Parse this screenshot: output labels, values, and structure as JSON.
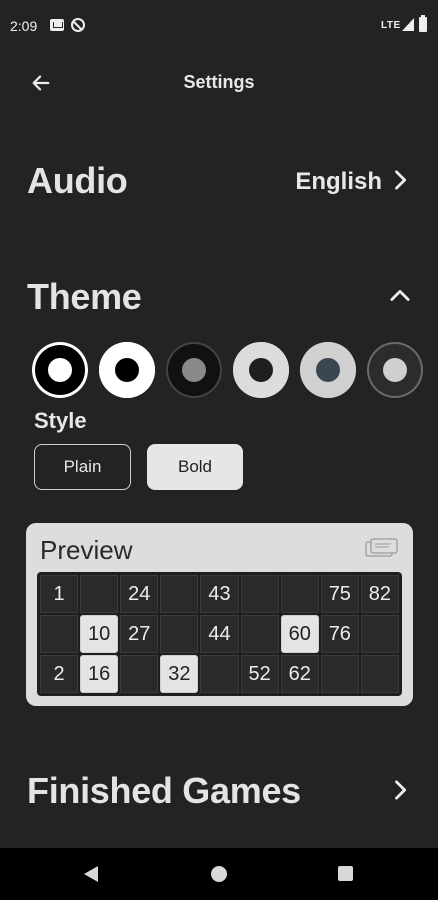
{
  "status": {
    "time": "2:09",
    "network": "LTE"
  },
  "app_bar": {
    "title": "Settings",
    "back_icon": "arrow-left-icon"
  },
  "audio": {
    "label": "Audio",
    "value": "English"
  },
  "theme": {
    "label": "Theme",
    "expanded": true,
    "swatches": [
      {
        "name": "black-white",
        "outer": "#000000",
        "ring": "#ffffff",
        "inner": "#ffffff",
        "selected": true
      },
      {
        "name": "white-black",
        "outer": "#ffffff",
        "ring": "#ffffff",
        "inner": "#000000",
        "selected": false
      },
      {
        "name": "black-gray",
        "outer": "#111111",
        "ring": "#444444",
        "inner": "#8a8a8a",
        "selected": false
      },
      {
        "name": "light-dark",
        "outer": "#dcdcdc",
        "ring": "#dcdcdc",
        "inner": "#1f1f1f",
        "selected": false
      },
      {
        "name": "gray-slate",
        "outer": "#d0d0d0",
        "ring": "#d0d0d0",
        "inner": "#3b4652",
        "selected": false
      },
      {
        "name": "dark-light",
        "outer": "#2c2c2c",
        "ring": "#6a6a6a",
        "inner": "#cfcfcf",
        "selected": false
      }
    ]
  },
  "style": {
    "label": "Style",
    "options": [
      "Plain",
      "Bold"
    ],
    "selected": "Bold"
  },
  "preview": {
    "title": "Preview",
    "rows": [
      [
        "1",
        "",
        "24",
        "",
        "43",
        "",
        "",
        "75",
        "82"
      ],
      [
        "",
        "10",
        "27",
        "",
        "44",
        "",
        "60",
        "76",
        ""
      ],
      [
        "2",
        "16",
        "",
        "32",
        "",
        "52",
        "62",
        "",
        ""
      ]
    ],
    "marked": [
      "10",
      "60",
      "16",
      "32"
    ]
  },
  "finished_games": {
    "label": "Finished Games"
  },
  "colors": {
    "background": "#232323",
    "card": "#dddddd"
  }
}
